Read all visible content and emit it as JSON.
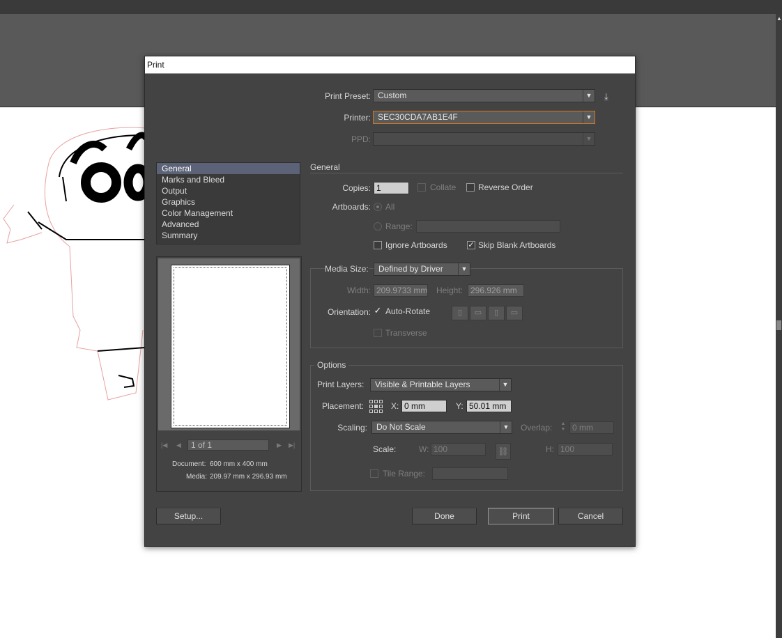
{
  "dialog": {
    "title": "Print"
  },
  "print_preset": {
    "label": "Print Preset:",
    "value": "Custom",
    "save_icon": "save-preset-icon"
  },
  "printer": {
    "label": "Printer:",
    "value": "SEC30CDA7AB1E4F"
  },
  "ppd": {
    "label": "PPD:",
    "value": ""
  },
  "categories": {
    "items": [
      {
        "label": "General",
        "active": true
      },
      {
        "label": "Marks and Bleed"
      },
      {
        "label": "Output"
      },
      {
        "label": "Graphics"
      },
      {
        "label": "Color Management"
      },
      {
        "label": "Advanced"
      },
      {
        "label": "Summary"
      }
    ]
  },
  "preview": {
    "page_indicator": "1 of 1",
    "document_label": "Document:",
    "document_value": "600 mm x 400 mm",
    "media_label": "Media:",
    "media_value": "209.97 mm x 296.93 mm"
  },
  "general": {
    "section_title": "General",
    "copies_label": "Copies:",
    "copies_value": "1",
    "collate_label": "Collate",
    "reverse_order_label": "Reverse Order",
    "artboards_label": "Artboards:",
    "all_label": "All",
    "range_label": "Range:",
    "range_value": "",
    "ignore_artboards_label": "Ignore Artboards",
    "skip_blank_label": "Skip Blank Artboards",
    "collate_checked": false,
    "reverse_order_checked": false,
    "ignore_artboards_checked": false,
    "skip_blank_checked": true
  },
  "media": {
    "size_label": "Media Size:",
    "size_value": "Defined by Driver",
    "width_label": "Width:",
    "width_value": "209.9733 mm",
    "height_label": "Height:",
    "height_value": "296.926 mm",
    "orientation_label": "Orientation:",
    "auto_rotate_label": "Auto-Rotate",
    "auto_rotate_checked": true,
    "transverse_label": "Transverse",
    "transverse_checked": false
  },
  "options": {
    "group_title": "Options",
    "print_layers_label": "Print Layers:",
    "print_layers_value": "Visible & Printable Layers",
    "placement_label": "Placement:",
    "x_label": "X:",
    "x_value": "0 mm",
    "y_label": "Y:",
    "y_value": "50.01 mm",
    "scaling_label": "Scaling:",
    "scaling_value": "Do Not Scale",
    "overlap_label": "Overlap:",
    "overlap_value": "0 mm",
    "scale_label": "Scale:",
    "w_label": "W:",
    "w_value": "100",
    "h_label": "H:",
    "h_value": "100",
    "tile_range_label": "Tile Range:",
    "tile_range_value": ""
  },
  "buttons": {
    "setup": "Setup...",
    "done": "Done",
    "print": "Print",
    "cancel": "Cancel"
  }
}
